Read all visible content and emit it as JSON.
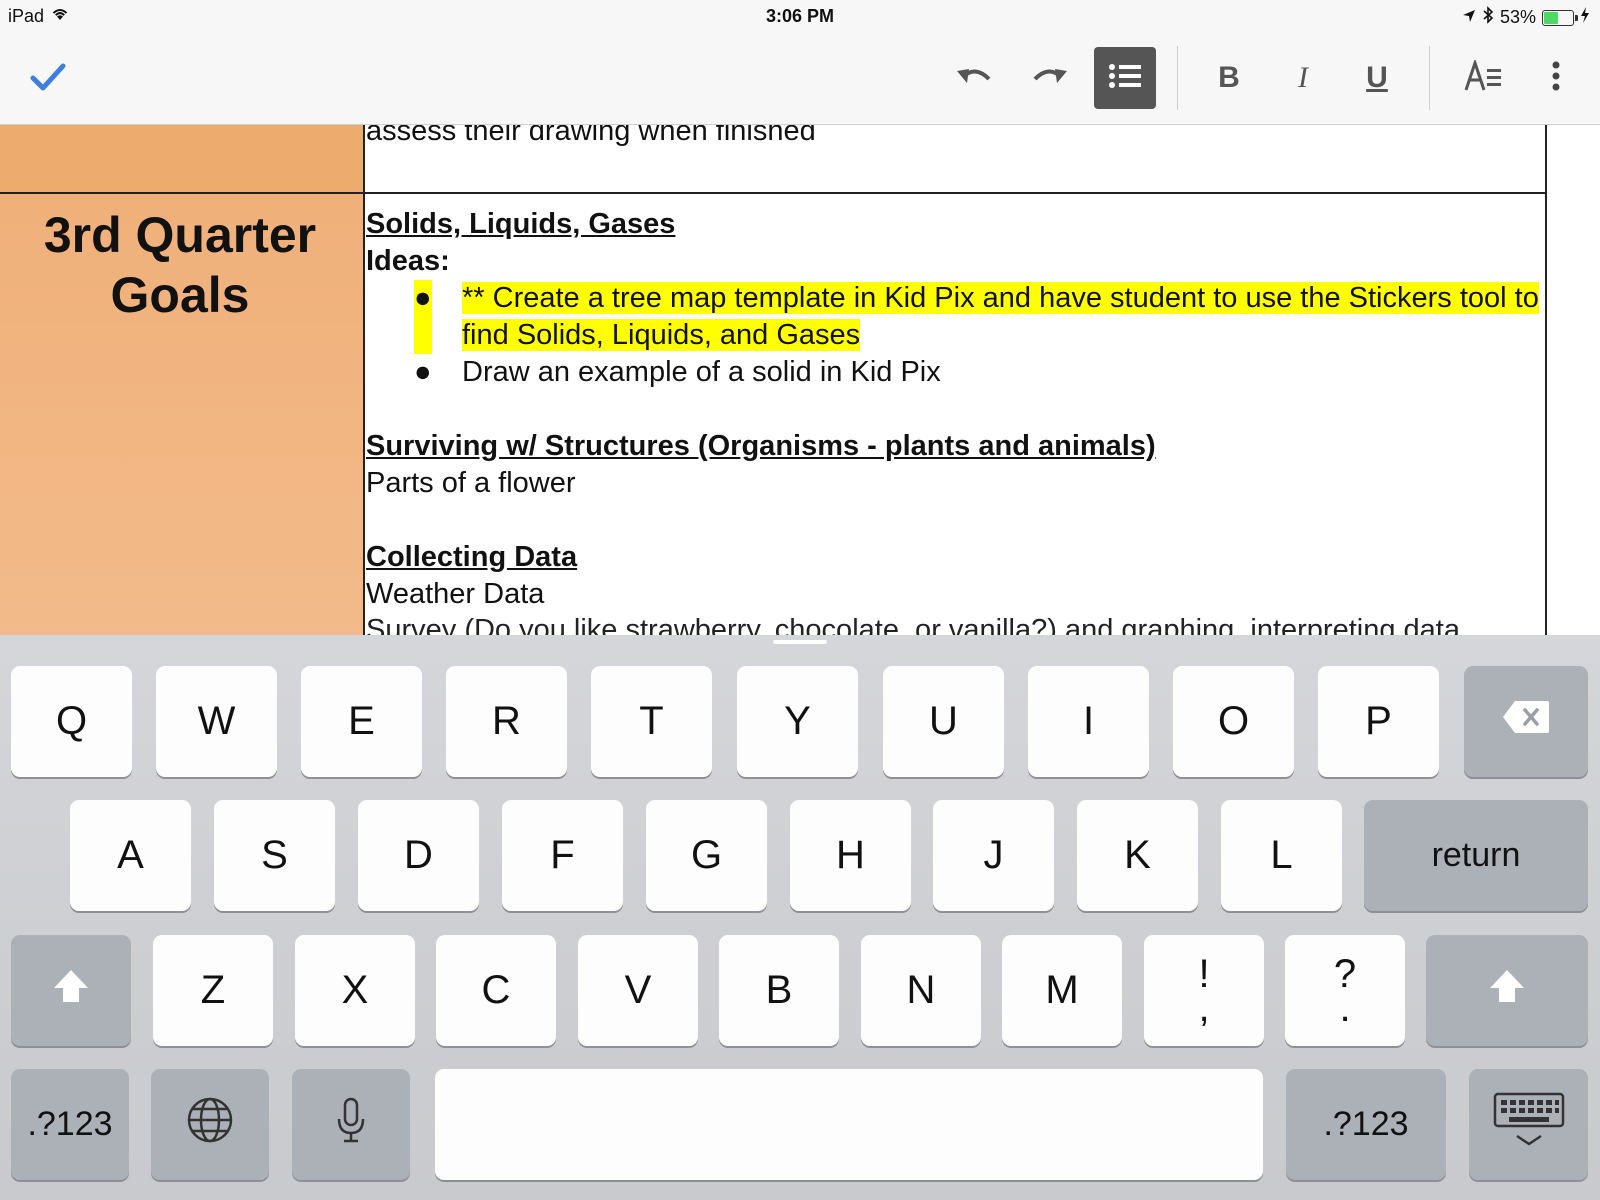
{
  "status_bar": {
    "device": "iPad",
    "time": "3:06 PM",
    "battery_percent": "53%",
    "battery_level": 0.53,
    "battery_color": "#4cd964"
  },
  "toolbar": {
    "done_icon": "checkmark-icon",
    "accent": "#3d7ee0",
    "buttons": [
      "undo-icon",
      "redo-icon",
      "bulleted-list-icon",
      "bold-icon",
      "italic-icon",
      "underline-icon",
      "text-format-icon",
      "more-options-icon"
    ],
    "bold_label": "B",
    "italic_label": "I",
    "underline_label": "U"
  },
  "document": {
    "previous_row_text": "assess their drawing when finished",
    "row_label": "3rd Quarter Goals",
    "left_cell_color": "#f0b07a",
    "highlight_color": "#ffff00",
    "sections": {
      "s1_title": "Solids, Liquids, Gases",
      "s1_ideas": "Ideas:",
      "s1_bullet1": "** Create a tree map template in Kid Pix and have student to use the Stickers tool to find Solids, Liquids, and Gases",
      "s1_bullet2": "Draw an example of a solid in Kid Pix",
      "s2_title": "Surviving w/ Structures (Organisms - plants and animals)",
      "s2_line1": "Parts of a flower",
      "s3_title": "Collecting Data",
      "s3_line1": "Weather Data",
      "s3_line2": "Survey (Do you like strawberry, chocolate, or vanilla?) and graphing, interpreting data"
    },
    "bullet_glyph": "●"
  },
  "keyboard": {
    "row1": [
      "Q",
      "W",
      "E",
      "R",
      "T",
      "Y",
      "U",
      "I",
      "O",
      "P"
    ],
    "row2": [
      "A",
      "S",
      "D",
      "F",
      "G",
      "H",
      "J",
      "K",
      "L"
    ],
    "row3": [
      "Z",
      "X",
      "C",
      "V",
      "B",
      "N",
      "M"
    ],
    "punct1_top": "!",
    "punct1_bottom": ",",
    "punct2_top": "?",
    "punct2_bottom": ".",
    "return_label": "return",
    "numbers_label": ".?123",
    "icons": [
      "delete-icon",
      "shift-icon",
      "globe-icon",
      "microphone-icon",
      "hide-keyboard-icon"
    ]
  }
}
